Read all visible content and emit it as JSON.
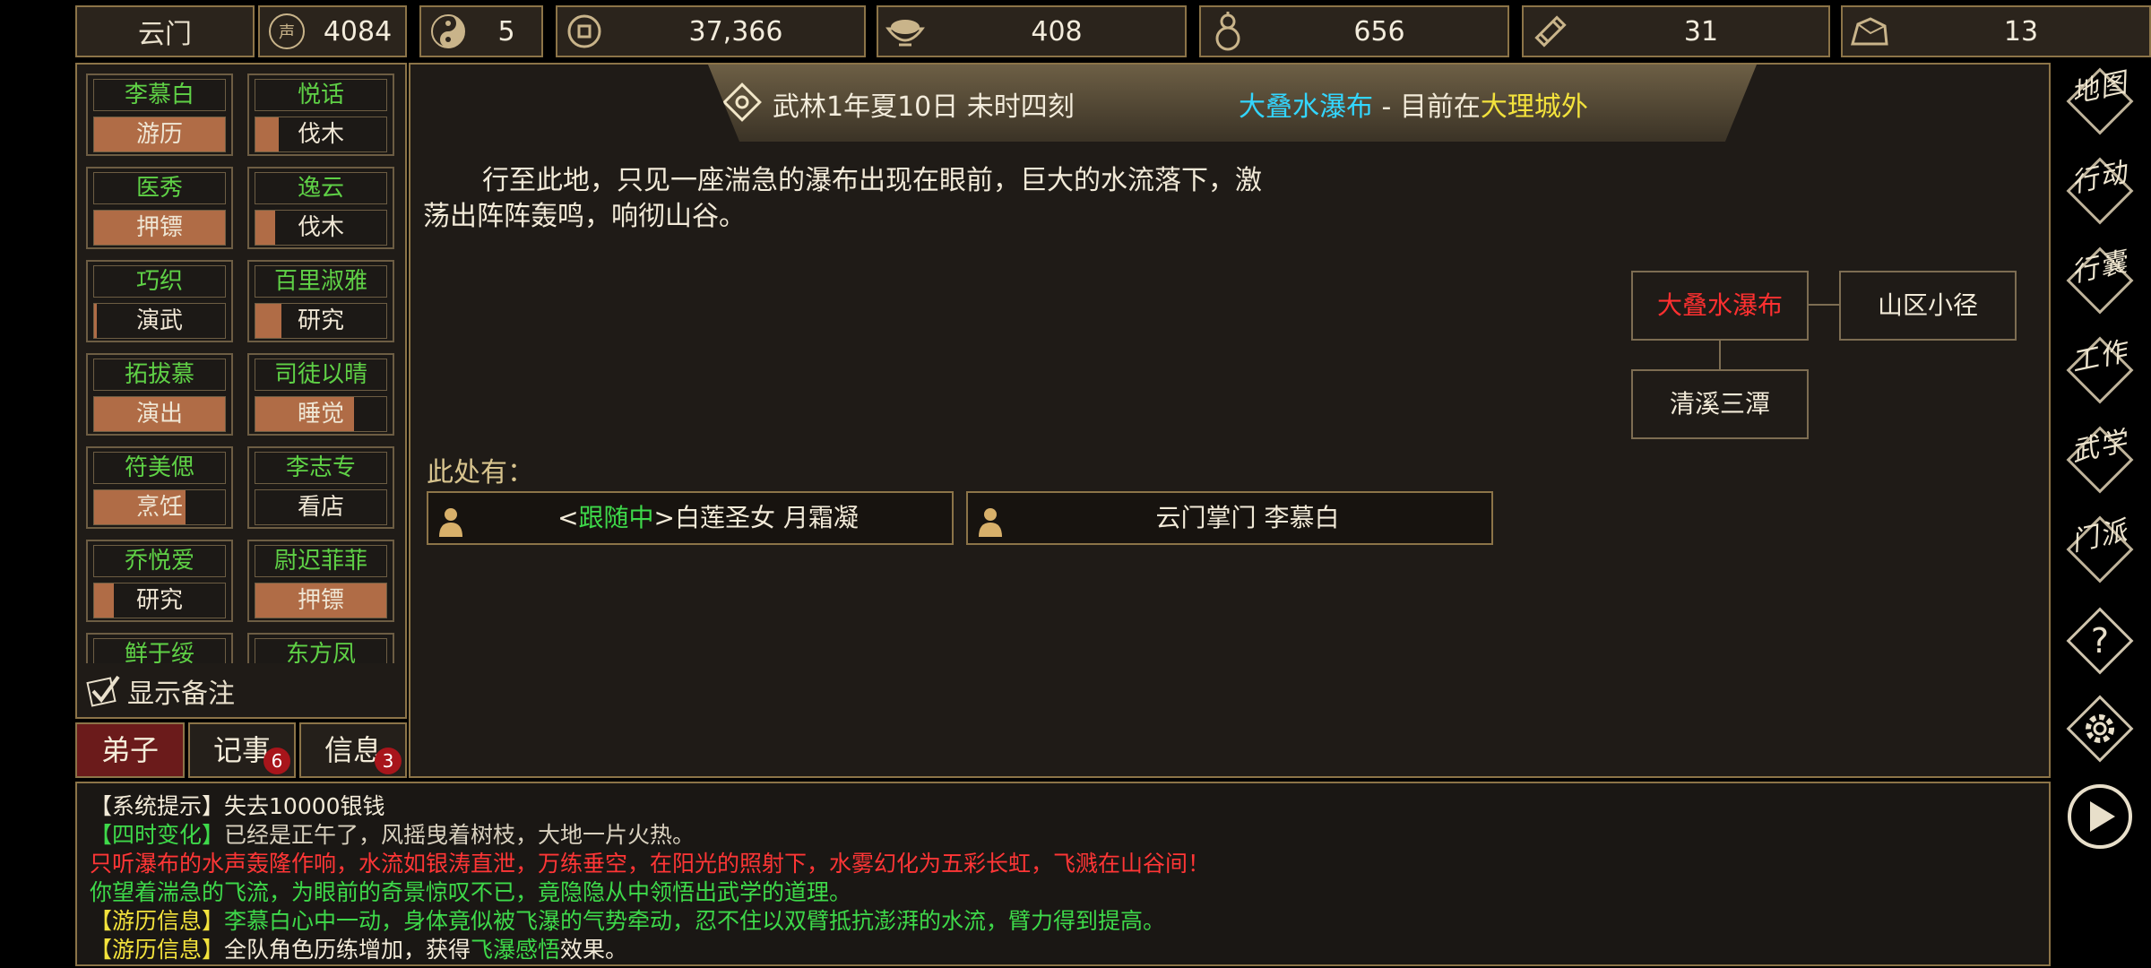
{
  "topbar": {
    "sect_name": "云门",
    "resources": [
      {
        "icon": "reputation-icon",
        "value": "4084"
      },
      {
        "icon": "yin-yang-icon",
        "value": "5"
      },
      {
        "icon": "coin-icon",
        "value": "37,366"
      },
      {
        "icon": "food-bowl-icon",
        "value": "408"
      },
      {
        "icon": "gourd-icon",
        "value": "656"
      },
      {
        "icon": "scroll-icon",
        "value": "31"
      },
      {
        "icon": "ore-icon",
        "value": "13"
      }
    ]
  },
  "disciples": [
    {
      "name": "李慕白",
      "task": "游历",
      "progress": 1.0
    },
    {
      "name": "悦话",
      "task": "伐木",
      "progress": 0.18
    },
    {
      "name": "医秀",
      "task": "押镖",
      "progress": 1.0
    },
    {
      "name": "逸云",
      "task": "伐木",
      "progress": 0.15
    },
    {
      "name": "巧织",
      "task": "演武",
      "progress": 0.02
    },
    {
      "name": "百里淑雅",
      "task": "研究",
      "progress": 0.2
    },
    {
      "name": "拓拔慕",
      "task": "演出",
      "progress": 1.0
    },
    {
      "name": "司徒以晴",
      "task": "睡觉",
      "progress": 0.75
    },
    {
      "name": "符美偲",
      "task": "烹饪",
      "progress": 0.7
    },
    {
      "name": "李志专",
      "task": "看店",
      "progress": 0.0
    },
    {
      "name": "乔悦爱",
      "task": "研究",
      "progress": 0.15
    },
    {
      "name": "尉迟菲菲",
      "task": "押镖",
      "progress": 1.0
    },
    {
      "name": "鲜于绥",
      "task": "",
      "progress": 0.0
    },
    {
      "name": "东方凤",
      "task": "",
      "progress": 0.0
    }
  ],
  "show_notes_label": "显示备注",
  "tabs": [
    {
      "label": "弟子",
      "badge": ""
    },
    {
      "label": "记事",
      "badge": "6"
    },
    {
      "label": "信息",
      "badge": "3"
    }
  ],
  "header": {
    "date": "武林1年夏10日 未时四刻",
    "location": "大叠水瀑布",
    "dash": " - ",
    "currently_at": "目前在",
    "region": "大理城外"
  },
  "description_line1": "行至此地，只见一座湍急的瀑布出现在眼前，巨大的水流落下，激",
  "description_line2": "荡出阵阵轰鸣，响彻山谷。",
  "map_nodes": {
    "current": "大叠水瀑布",
    "east": "山区小径",
    "south": "清溪三潭"
  },
  "here_label": "此处有：",
  "people": [
    {
      "prefix": "<",
      "tag": "跟随中",
      "suffix": ">",
      "name": "白莲圣女 月霜凝"
    },
    {
      "name": "云门掌门 李慕白"
    }
  ],
  "log": [
    {
      "tag": "【系统提示】",
      "text": "失去10000银钱"
    },
    {
      "tag": "【四时变化】",
      "text": "已经是正午了，风摇曳着树枝，大地一片火热。"
    },
    {
      "text": "只听瀑布的水声轰隆作响，水流如银涛直泄，万练垂空，在阳光的照射下，水雾幻化为五彩长虹，飞溅在山谷间！"
    },
    {
      "text": "你望着湍急的飞流，为眼前的奇景惊叹不已，竟隐隐从中领悟出武学的道理。"
    },
    {
      "tag": "【游历信息】",
      "text": "李慕白心中一动，身体竟似被飞瀑的气势牵动，忍不住以双臂抵抗澎湃的水流，臂力得到提高。"
    },
    {
      "tag": "【游历信息】",
      "text_a": "全队角色历练增加，获得",
      "highlight": "飞瀑感悟",
      "text_b": "效果。"
    }
  ],
  "right_menu": [
    "地图",
    "行动",
    "行囊",
    "工作",
    "武学",
    "门派"
  ],
  "colors": {
    "accent_green": "#3ed94a",
    "accent_yellow": "#f3e23c",
    "accent_cyan": "#33d6ff",
    "accent_red": "#ff3636",
    "border_gold": "#8c7448",
    "progress": "#b06c46"
  }
}
